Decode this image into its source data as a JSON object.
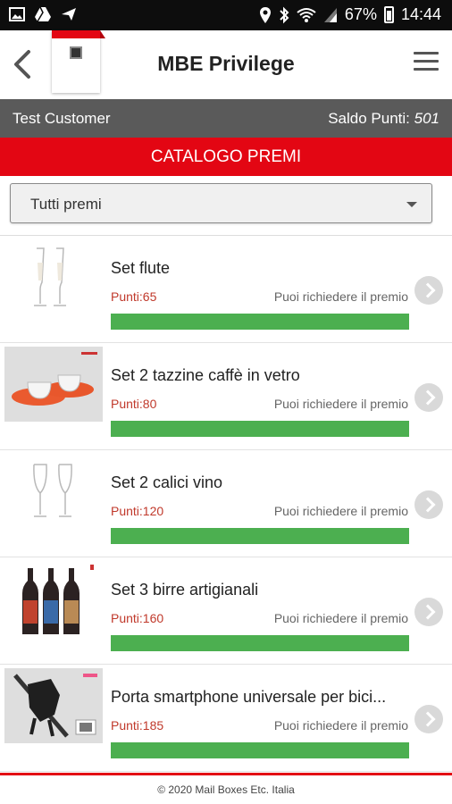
{
  "statusbar": {
    "battery": "67%",
    "time": "14:44"
  },
  "appbar": {
    "title": "MBE Privilege"
  },
  "customer": {
    "name": "Test Customer",
    "points_label": "Saldo Punti:",
    "points_value": "501"
  },
  "section": {
    "title": "CATALOGO PREMI"
  },
  "filter": {
    "value": "Tutti premi"
  },
  "items": [
    {
      "name": "Set flute",
      "points": "Punti:65",
      "status": "Puoi richiedere il premio",
      "progress": 1.0,
      "image": "champagne-flutes"
    },
    {
      "name": "Set 2 tazzine caffè in vetro",
      "points": "Punti:80",
      "status": "Puoi richiedere il premio",
      "progress": 1.0,
      "image": "glass-espresso-cups"
    },
    {
      "name": "Set 2 calici vino",
      "points": "Punti:120",
      "status": "Puoi richiedere il premio",
      "progress": 1.0,
      "image": "wine-glasses"
    },
    {
      "name": "Set 3 birre artigianali",
      "points": "Punti:160",
      "status": "Puoi richiedere il premio",
      "progress": 1.0,
      "image": "craft-beer-bottles"
    },
    {
      "name": "Porta smartphone universale per bici...",
      "points": "Punti:185",
      "status": "Puoi richiedere il premio",
      "progress": 1.0,
      "image": "bike-phone-holder"
    }
  ],
  "footer": {
    "text": "© 2020 Mail Boxes Etc. Italia"
  },
  "colors": {
    "brand_red": "#e30613",
    "customer_bar": "#5a5a5a",
    "progress_green": "#4caf50",
    "points_red": "#c0392b"
  }
}
